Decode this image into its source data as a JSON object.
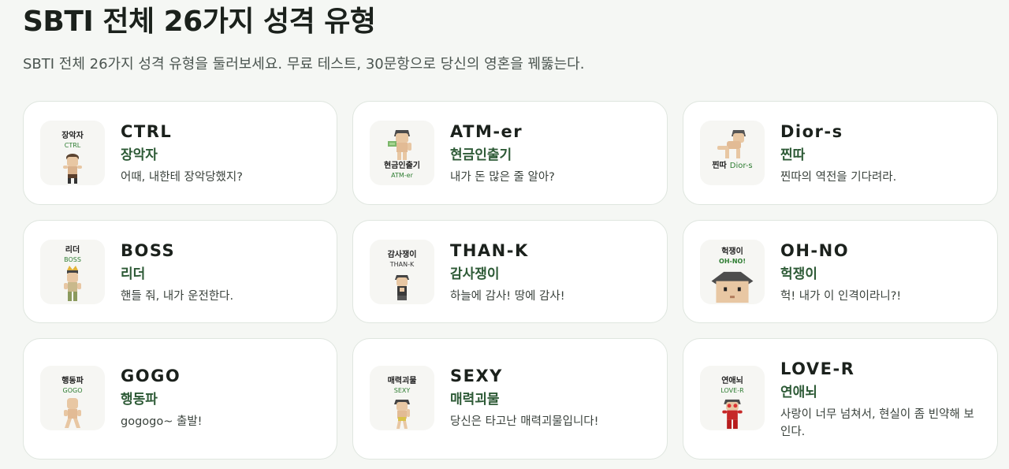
{
  "page": {
    "title": "SBTI 전체 26가지 성격 유형",
    "subtitle": "SBTI 전체 26가지 성격 유형을 둘러보세요. 무료 테스트, 30문항으로 당신의 영혼을 꿰뚫는다."
  },
  "colors": {
    "accent": "#2d5a36",
    "thumb_label_en": "#2e7d32",
    "background": "#f5f7f4"
  },
  "cards": [
    {
      "code": "CTRL",
      "name": "장악자",
      "desc": "어때, 내한테 장악당했지?",
      "thumb_ko": "장악자",
      "thumb_en": "CTRL",
      "icon": "ctrl-character-icon"
    },
    {
      "code": "ATM-er",
      "name": "현금인출기",
      "desc": "내가 돈 많은 줄 알아?",
      "thumb_ko": "현금인출기",
      "thumb_en": "ATM-er",
      "icon": "atm-character-icon"
    },
    {
      "code": "Dior-s",
      "name": "찐따",
      "desc": "찐따의 역전을 기다려라.",
      "thumb_ko": "찐따",
      "thumb_en": "Dior-s",
      "icon": "dior-character-icon"
    },
    {
      "code": "BOSS",
      "name": "리더",
      "desc": "핸들 줘, 내가 운전한다.",
      "thumb_ko": "리더",
      "thumb_en": "BOSS",
      "icon": "boss-character-icon"
    },
    {
      "code": "THAN-K",
      "name": "감사쟁이",
      "desc": "하늘에 감사! 땅에 감사!",
      "thumb_ko": "감사쟁이",
      "thumb_en": "THAN-K",
      "icon": "thank-character-icon"
    },
    {
      "code": "OH-NO",
      "name": "헉쟁이",
      "desc": "헉! 내가 이 인격이라니?!",
      "thumb_ko": "헉쟁이",
      "thumb_en": "OH-NO!",
      "icon": "ohno-character-icon"
    },
    {
      "code": "GOGO",
      "name": "행동파",
      "desc": "gogogo~ 출발!",
      "thumb_ko": "행동파",
      "thumb_en": "GOGO",
      "icon": "gogo-character-icon"
    },
    {
      "code": "SEXY",
      "name": "매력괴물",
      "desc": "당신은 타고난 매력괴물입니다!",
      "thumb_ko": "매력괴물",
      "thumb_en": "SEXY",
      "icon": "sexy-character-icon"
    },
    {
      "code": "LOVE-R",
      "name": "연애뇌",
      "desc": "사랑이 너무 넘쳐서, 현실이 좀 빈약해 보인다.",
      "thumb_ko": "연애뇌",
      "thumb_en": "LOVE-R",
      "icon": "lover-character-icon"
    }
  ]
}
